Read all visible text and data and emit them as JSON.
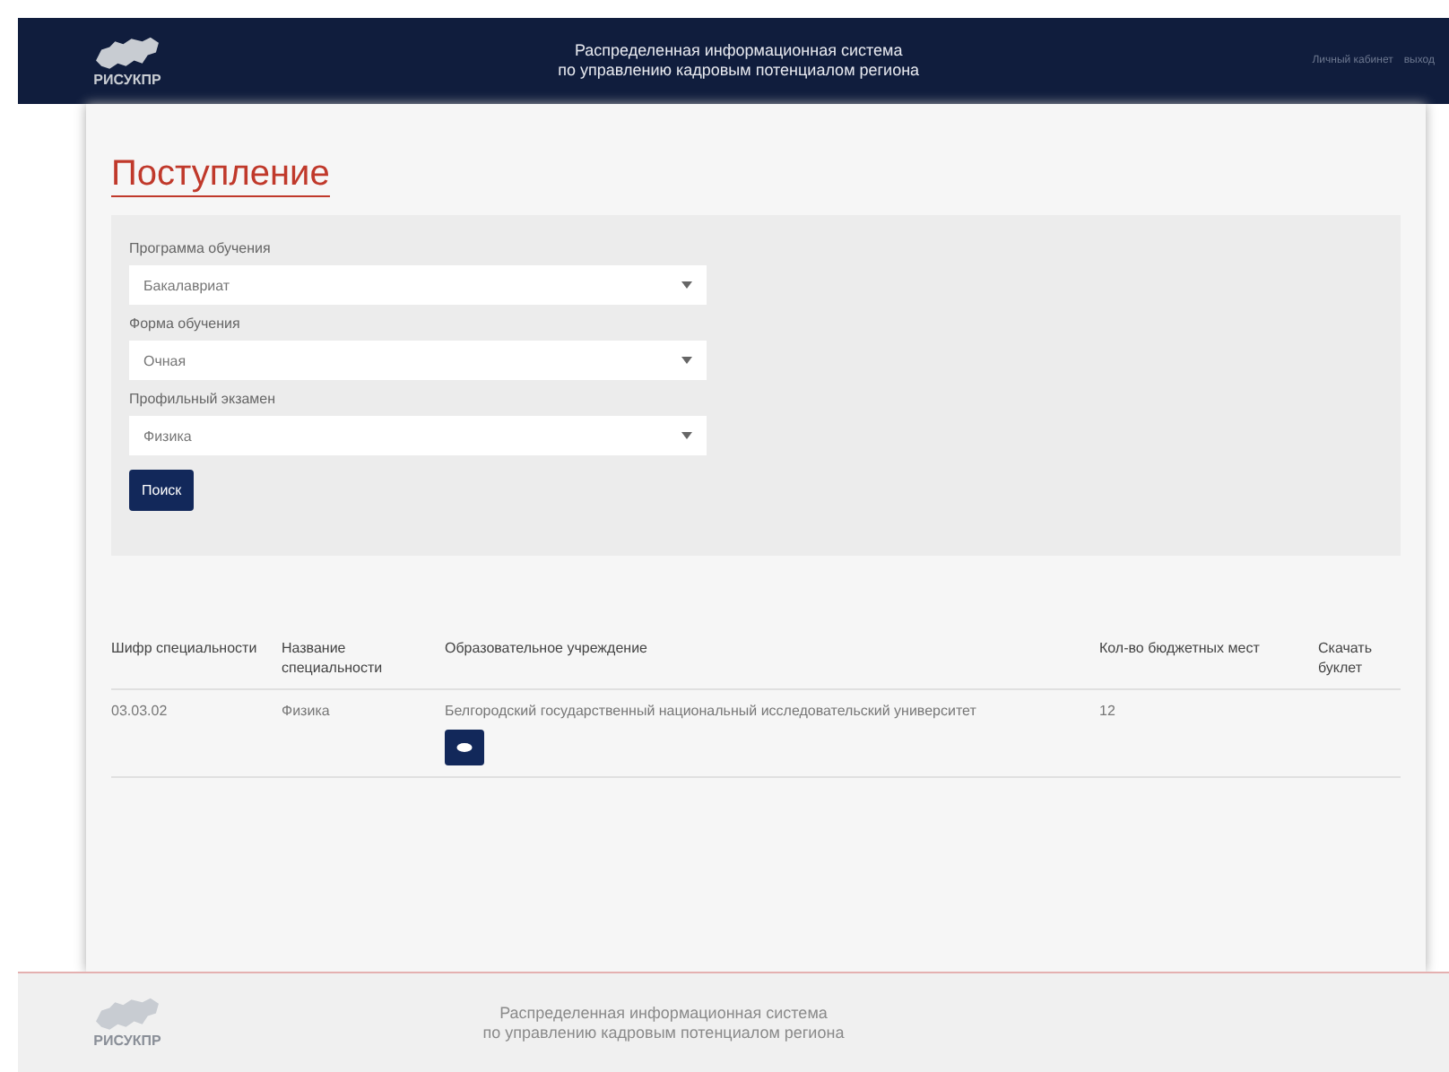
{
  "header": {
    "logo_text": "РИСУКПР",
    "title_line1": "Распределенная информационная система",
    "title_line2": "по управлению кадровым потенциалом региона",
    "account_link": "Личный кабинет",
    "logout_link": "выход"
  },
  "page_title": "Поступление",
  "filters": [
    {
      "label": "Программа обучения",
      "value": "Бакалавриат"
    },
    {
      "label": "Форма обучения",
      "value": "Очная"
    },
    {
      "label": "Профильный экзамен",
      "value": "Физика"
    }
  ],
  "search_button": "Поиск",
  "table": {
    "columns": [
      "Шифр специальности",
      "Название специальности",
      "Образовательное учреждение",
      "Кол-во бюджетных мест",
      "Скачать буклет"
    ],
    "rows": [
      {
        "cells": [
          "03.03.02",
          "Физика",
          "Белгородский государственный национальный исследовательский университет",
          "12"
        ],
        "has_view_button": true
      }
    ]
  },
  "footer": {
    "logo_text": "РИСУКПР",
    "line1": "Распределенная информационная система",
    "line2": "по управлению кадровым потенциалом региона"
  }
}
